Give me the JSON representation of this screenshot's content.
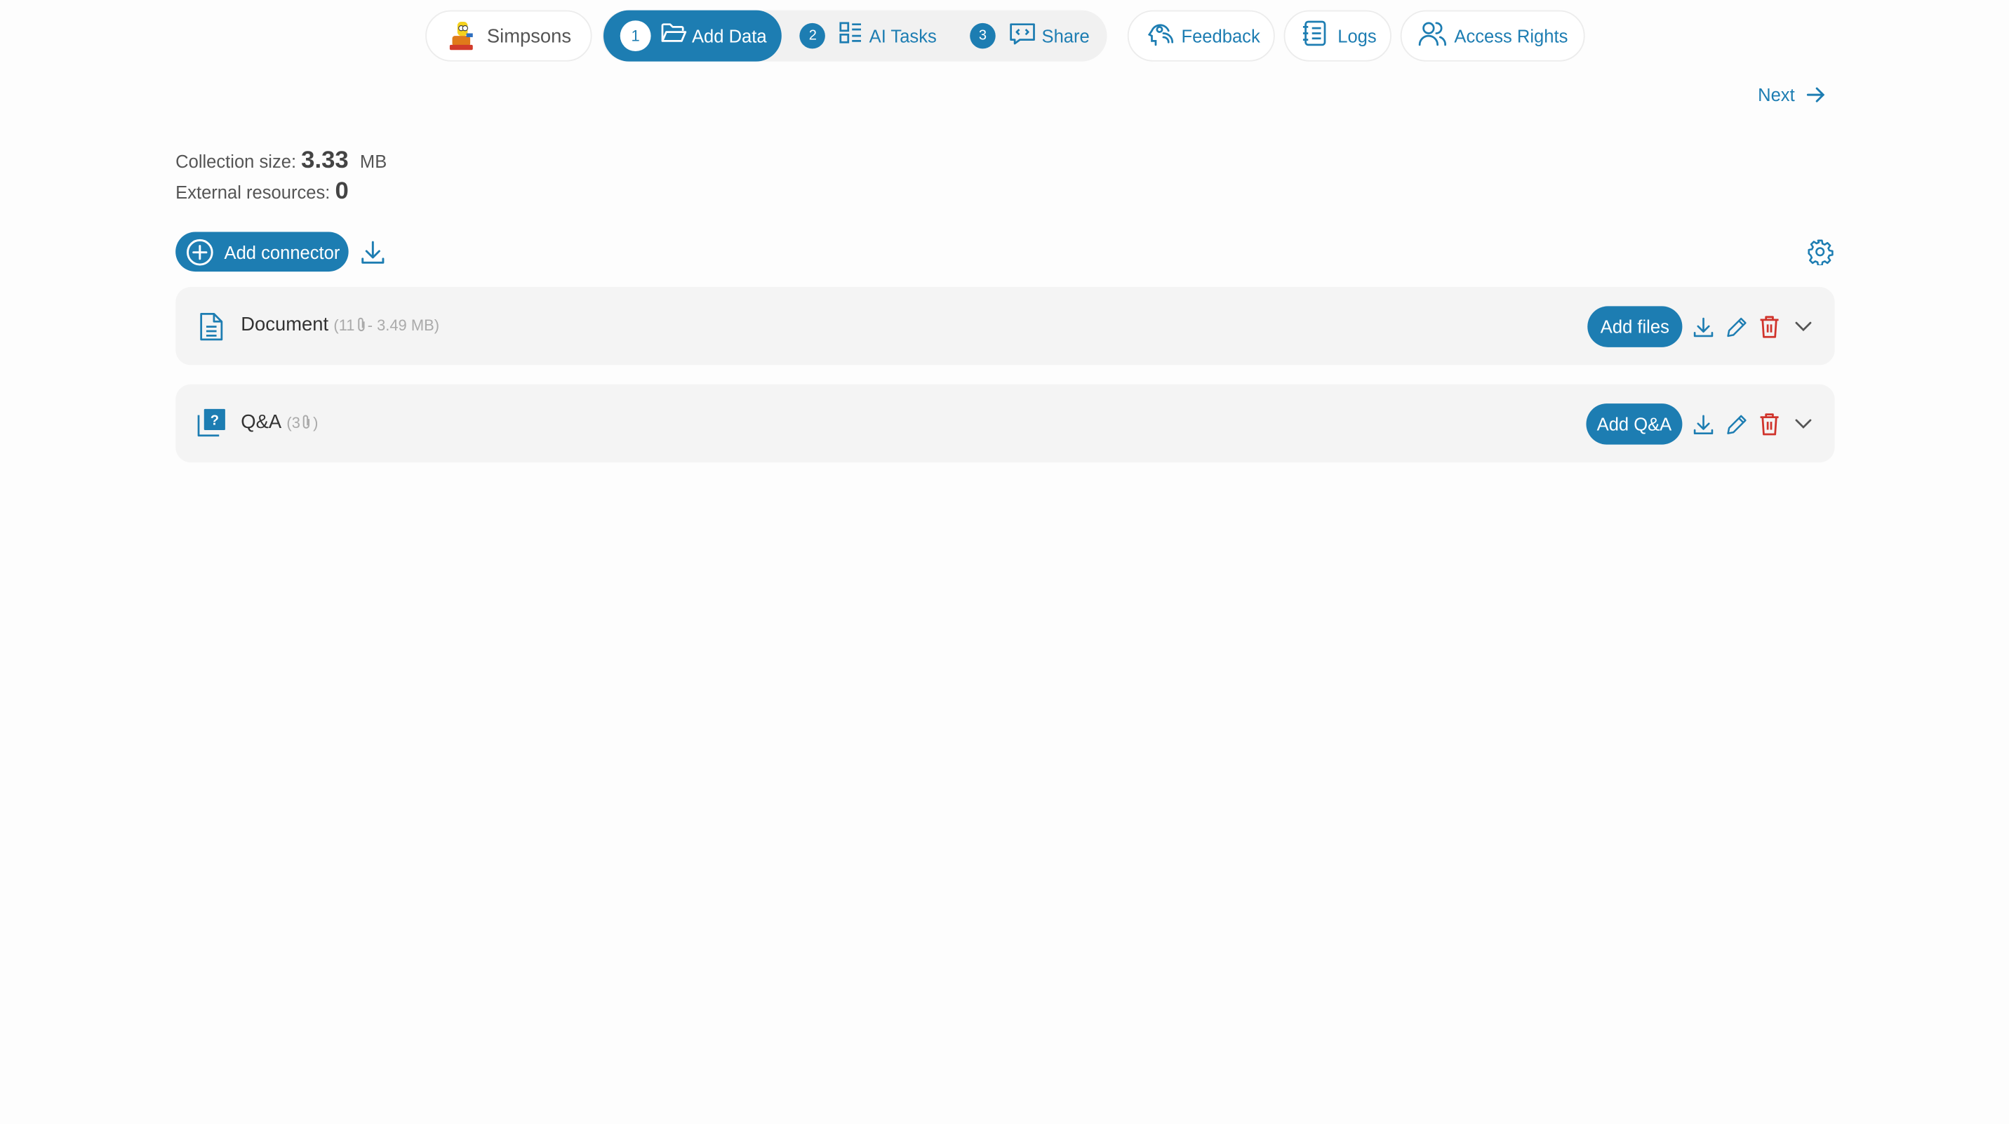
{
  "nav": {
    "collection_name": "Simpsons",
    "steps": [
      {
        "number": "1",
        "label": "Add Data"
      },
      {
        "number": "2",
        "label": "AI Tasks"
      },
      {
        "number": "3",
        "label": "Share"
      }
    ],
    "feedback": "Feedback",
    "logs": "Logs",
    "access_rights": "Access Rights",
    "next": "Next"
  },
  "stats": {
    "collection_size_label": "Collection size:",
    "collection_size_value": "3.33",
    "collection_size_unit": "MB",
    "external_label": "External resources:",
    "external_value": "0"
  },
  "toolbar": {
    "add_connector": "Add connector"
  },
  "connectors": [
    {
      "name": "Document",
      "count_open": "(11",
      "size": "- 3.49 MB)",
      "action": "Add files"
    },
    {
      "name": "Q&A",
      "count_open": "(3",
      "size": ")",
      "action": "Add Q&A"
    }
  ],
  "colors": {
    "accent": "#1d7db2",
    "danger": "#d0342c",
    "card_bg": "#f4f4f4"
  }
}
